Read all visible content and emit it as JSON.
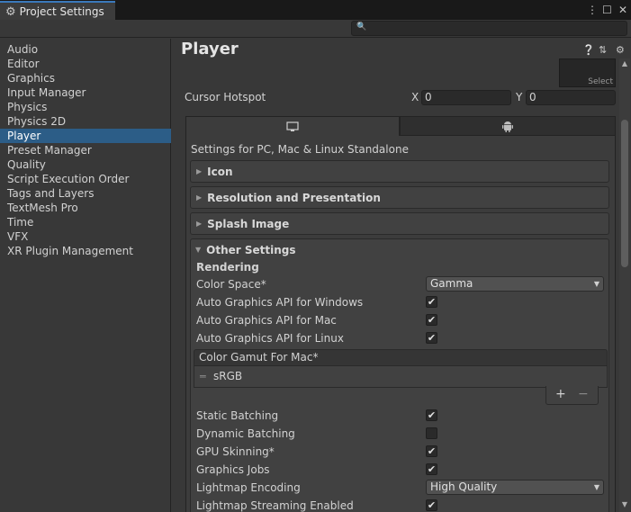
{
  "window": {
    "tab_title": "Project Settings",
    "menu_icon": "⋮",
    "maximize_icon": "☐",
    "close_icon": "✕"
  },
  "search": {
    "placeholder": "",
    "value": ""
  },
  "sidebar": {
    "items": [
      {
        "label": "Audio",
        "selected": false
      },
      {
        "label": "Editor",
        "selected": false
      },
      {
        "label": "Graphics",
        "selected": false
      },
      {
        "label": "Input Manager",
        "selected": false
      },
      {
        "label": "Physics",
        "selected": false
      },
      {
        "label": "Physics 2D",
        "selected": false
      },
      {
        "label": "Player",
        "selected": true
      },
      {
        "label": "Preset Manager",
        "selected": false
      },
      {
        "label": "Quality",
        "selected": false
      },
      {
        "label": "Script Execution Order",
        "selected": false
      },
      {
        "label": "Tags and Layers",
        "selected": false
      },
      {
        "label": "TextMesh Pro",
        "selected": false
      },
      {
        "label": "Time",
        "selected": false
      },
      {
        "label": "VFX",
        "selected": false
      },
      {
        "label": "XR Plugin Management",
        "selected": false
      }
    ]
  },
  "main": {
    "title": "Player",
    "preview_select": "Select",
    "cursor_hotspot": {
      "label": "Cursor Hotspot",
      "x_label": "X",
      "x_value": "0",
      "y_label": "Y",
      "y_value": "0"
    },
    "settings_for": "Settings for PC, Mac & Linux Standalone",
    "foldouts": {
      "icon": "Icon",
      "resolution": "Resolution and Presentation",
      "splash": "Splash Image",
      "other": "Other Settings"
    },
    "rendering": {
      "header": "Rendering",
      "color_space_label": "Color Space*",
      "color_space_value": "Gamma",
      "auto_windows": "Auto Graphics API  for Windows",
      "auto_mac": "Auto Graphics API  for Mac",
      "auto_linux": "Auto Graphics API  for Linux",
      "gamut_header": "Color Gamut For Mac*",
      "gamut_item": "sRGB",
      "add": "+",
      "remove": "−",
      "static_batching": "Static Batching",
      "dynamic_batching": "Dynamic Batching",
      "gpu_skinning": "GPU Skinning*",
      "graphics_jobs": "Graphics Jobs",
      "lightmap_encoding_label": "Lightmap Encoding",
      "lightmap_encoding_value": "High Quality",
      "lightmap_streaming": "Lightmap Streaming Enabled"
    },
    "checks": {
      "auto_windows": true,
      "auto_mac": true,
      "auto_linux": true,
      "static_batching": true,
      "dynamic_batching": false,
      "gpu_skinning": true,
      "graphics_jobs": true,
      "lightmap_streaming": true
    }
  },
  "colors": {
    "accent": "#3a79bb",
    "selection": "#2c5d87",
    "background": "#383838"
  }
}
